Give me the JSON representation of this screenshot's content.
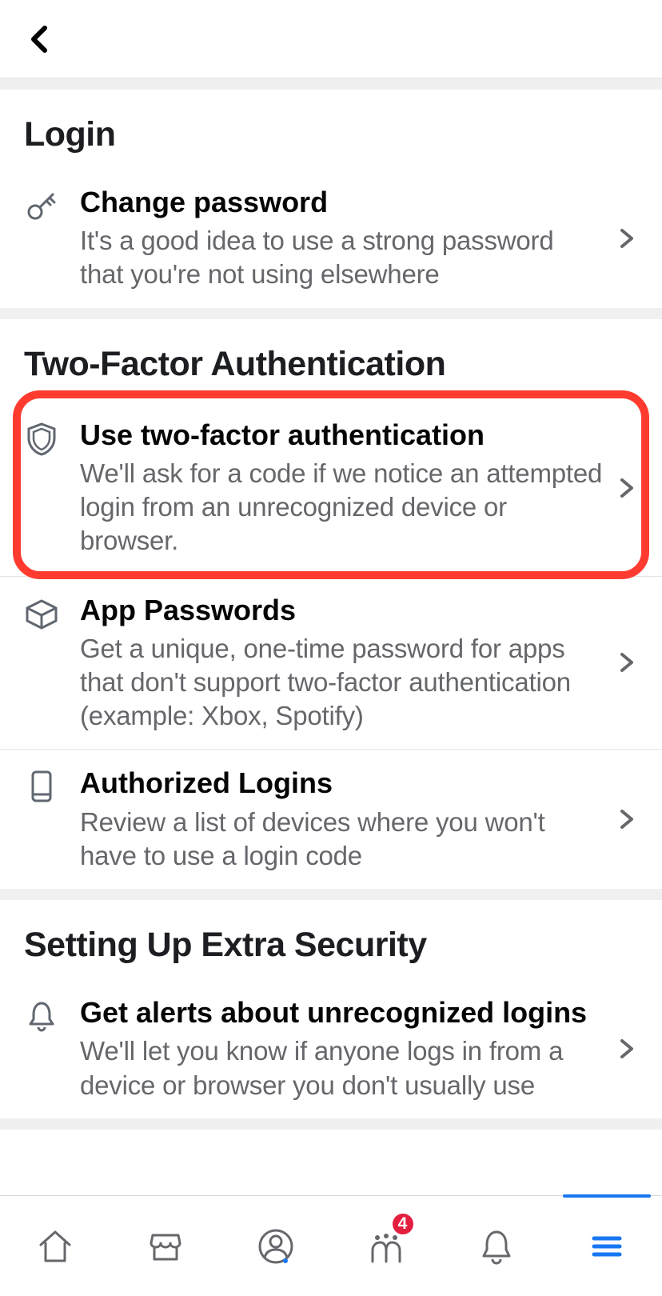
{
  "sections": [
    {
      "title": "Login",
      "items": [
        {
          "title": "Change password",
          "desc": "It's a good idea to use a strong password that you're not using elsewhere"
        }
      ]
    },
    {
      "title": "Two-Factor Authentication",
      "items": [
        {
          "title": "Use two-factor authentication",
          "desc": "We'll ask for a code if we notice an attempted login from an unrecognized device or browser."
        },
        {
          "title": "App Passwords",
          "desc": "Get a unique, one-time password for apps that don't support two-factor authentication (example: Xbox, Spotify)"
        },
        {
          "title": "Authorized Logins",
          "desc": "Review a list of devices where you won't have to use a login code"
        }
      ]
    },
    {
      "title": "Setting Up Extra Security",
      "items": [
        {
          "title": "Get alerts about unrecognized logins",
          "desc": "We'll let you know if anyone logs in from a device or browser you don't usually use"
        }
      ]
    }
  ],
  "tabs": {
    "badge": "4"
  }
}
